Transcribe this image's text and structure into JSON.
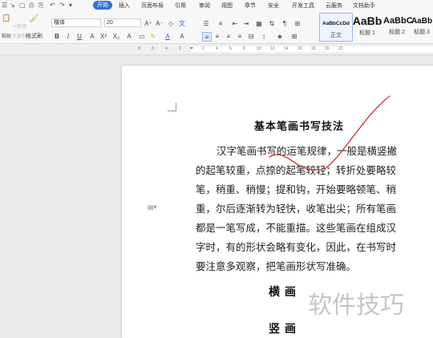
{
  "menubar": {
    "quick_access": [
      "☰",
      "↘",
      "▢",
      "⎙",
      "⎘",
      "↶",
      "↷",
      "▾"
    ],
    "tabs": [
      {
        "label": "开始",
        "active": true
      },
      {
        "label": "插入"
      },
      {
        "label": "页面布局"
      },
      {
        "label": "引用"
      },
      {
        "label": "审阅"
      },
      {
        "label": "视图"
      },
      {
        "label": "章节"
      },
      {
        "label": "安全"
      },
      {
        "label": "开发工具"
      },
      {
        "label": "云服务"
      },
      {
        "label": "文档助手"
      }
    ]
  },
  "ribbon": {
    "paste_label": "粘贴",
    "cut_label": "剪切",
    "copy_label": "复制",
    "format_painter_label": "格式刷",
    "font_name": "楷体",
    "font_size": "20",
    "styles": [
      {
        "sample": "AaBbCcDd",
        "label": "正文"
      },
      {
        "sample": "AaBb",
        "label": "标题 1"
      },
      {
        "sample": "AaBbC",
        "label": "标题 2"
      },
      {
        "sample": "AaBb",
        "label": "标题 3"
      }
    ]
  },
  "ruler": {
    "numbers": [
      "8",
      "6",
      "4",
      "2",
      "2",
      "4",
      "6",
      "8",
      "10",
      "12",
      "14",
      "16",
      "18",
      "20",
      "22"
    ]
  },
  "document": {
    "title": "基本笔画书写技法",
    "lines": [
      "汉字笔画书写的运笔规律，一般是横竖撇",
      "的起笔较重，点捺的起笔较轻；转折处要略较",
      "笔，稍重、稍慢；提和钩，开始要略顿笔、稍",
      "重，尔后逐渐转为轻快，收笔出尖；所有笔画",
      "都是一笔写成，不能重描。这些笔画在组成汉",
      "字时，有的形状会略有变化，因此，在书写时",
      "要注意多观察，把笔画形状写准确。"
    ],
    "heading_1": "横画",
    "heading_2": "竖画"
  },
  "watermark": "软件技巧",
  "colors": {
    "accent": "#2f6fe0",
    "annotation": "#d33b3b"
  }
}
